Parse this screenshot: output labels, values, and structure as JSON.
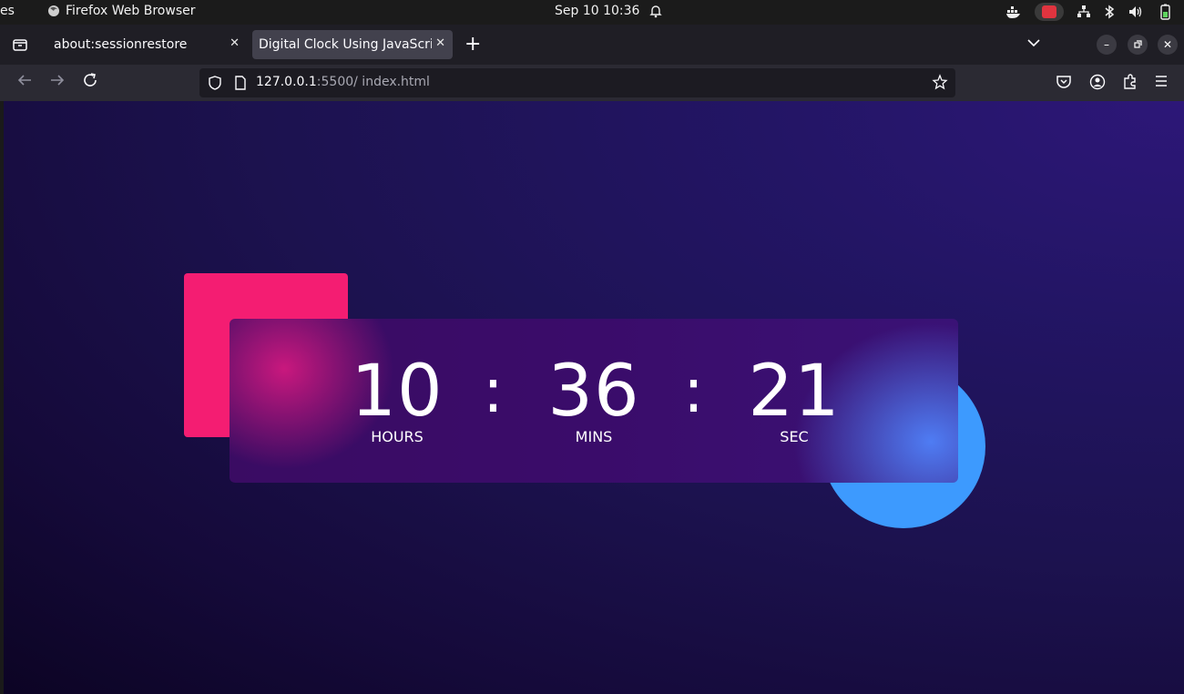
{
  "system": {
    "activities": "es",
    "app_name": "Firefox Web Browser",
    "datetime": "Sep 10  10:36"
  },
  "tabs": [
    {
      "title": "about:sessionrestore",
      "active": false
    },
    {
      "title": "Digital Clock Using JavaScript",
      "active": true
    }
  ],
  "address": {
    "host": "127.0.0.1",
    "rest": ":5500/ index.html"
  },
  "clock": {
    "hours": "10",
    "minutes": "36",
    "seconds": "21",
    "separator": ":",
    "hours_label": "HOURS",
    "minutes_label": "MINS",
    "seconds_label": "SEC"
  },
  "colors": {
    "square": "#f41d72",
    "circle": "#3d9afe",
    "panel": "#3a0c63",
    "background": "#1c124f"
  }
}
